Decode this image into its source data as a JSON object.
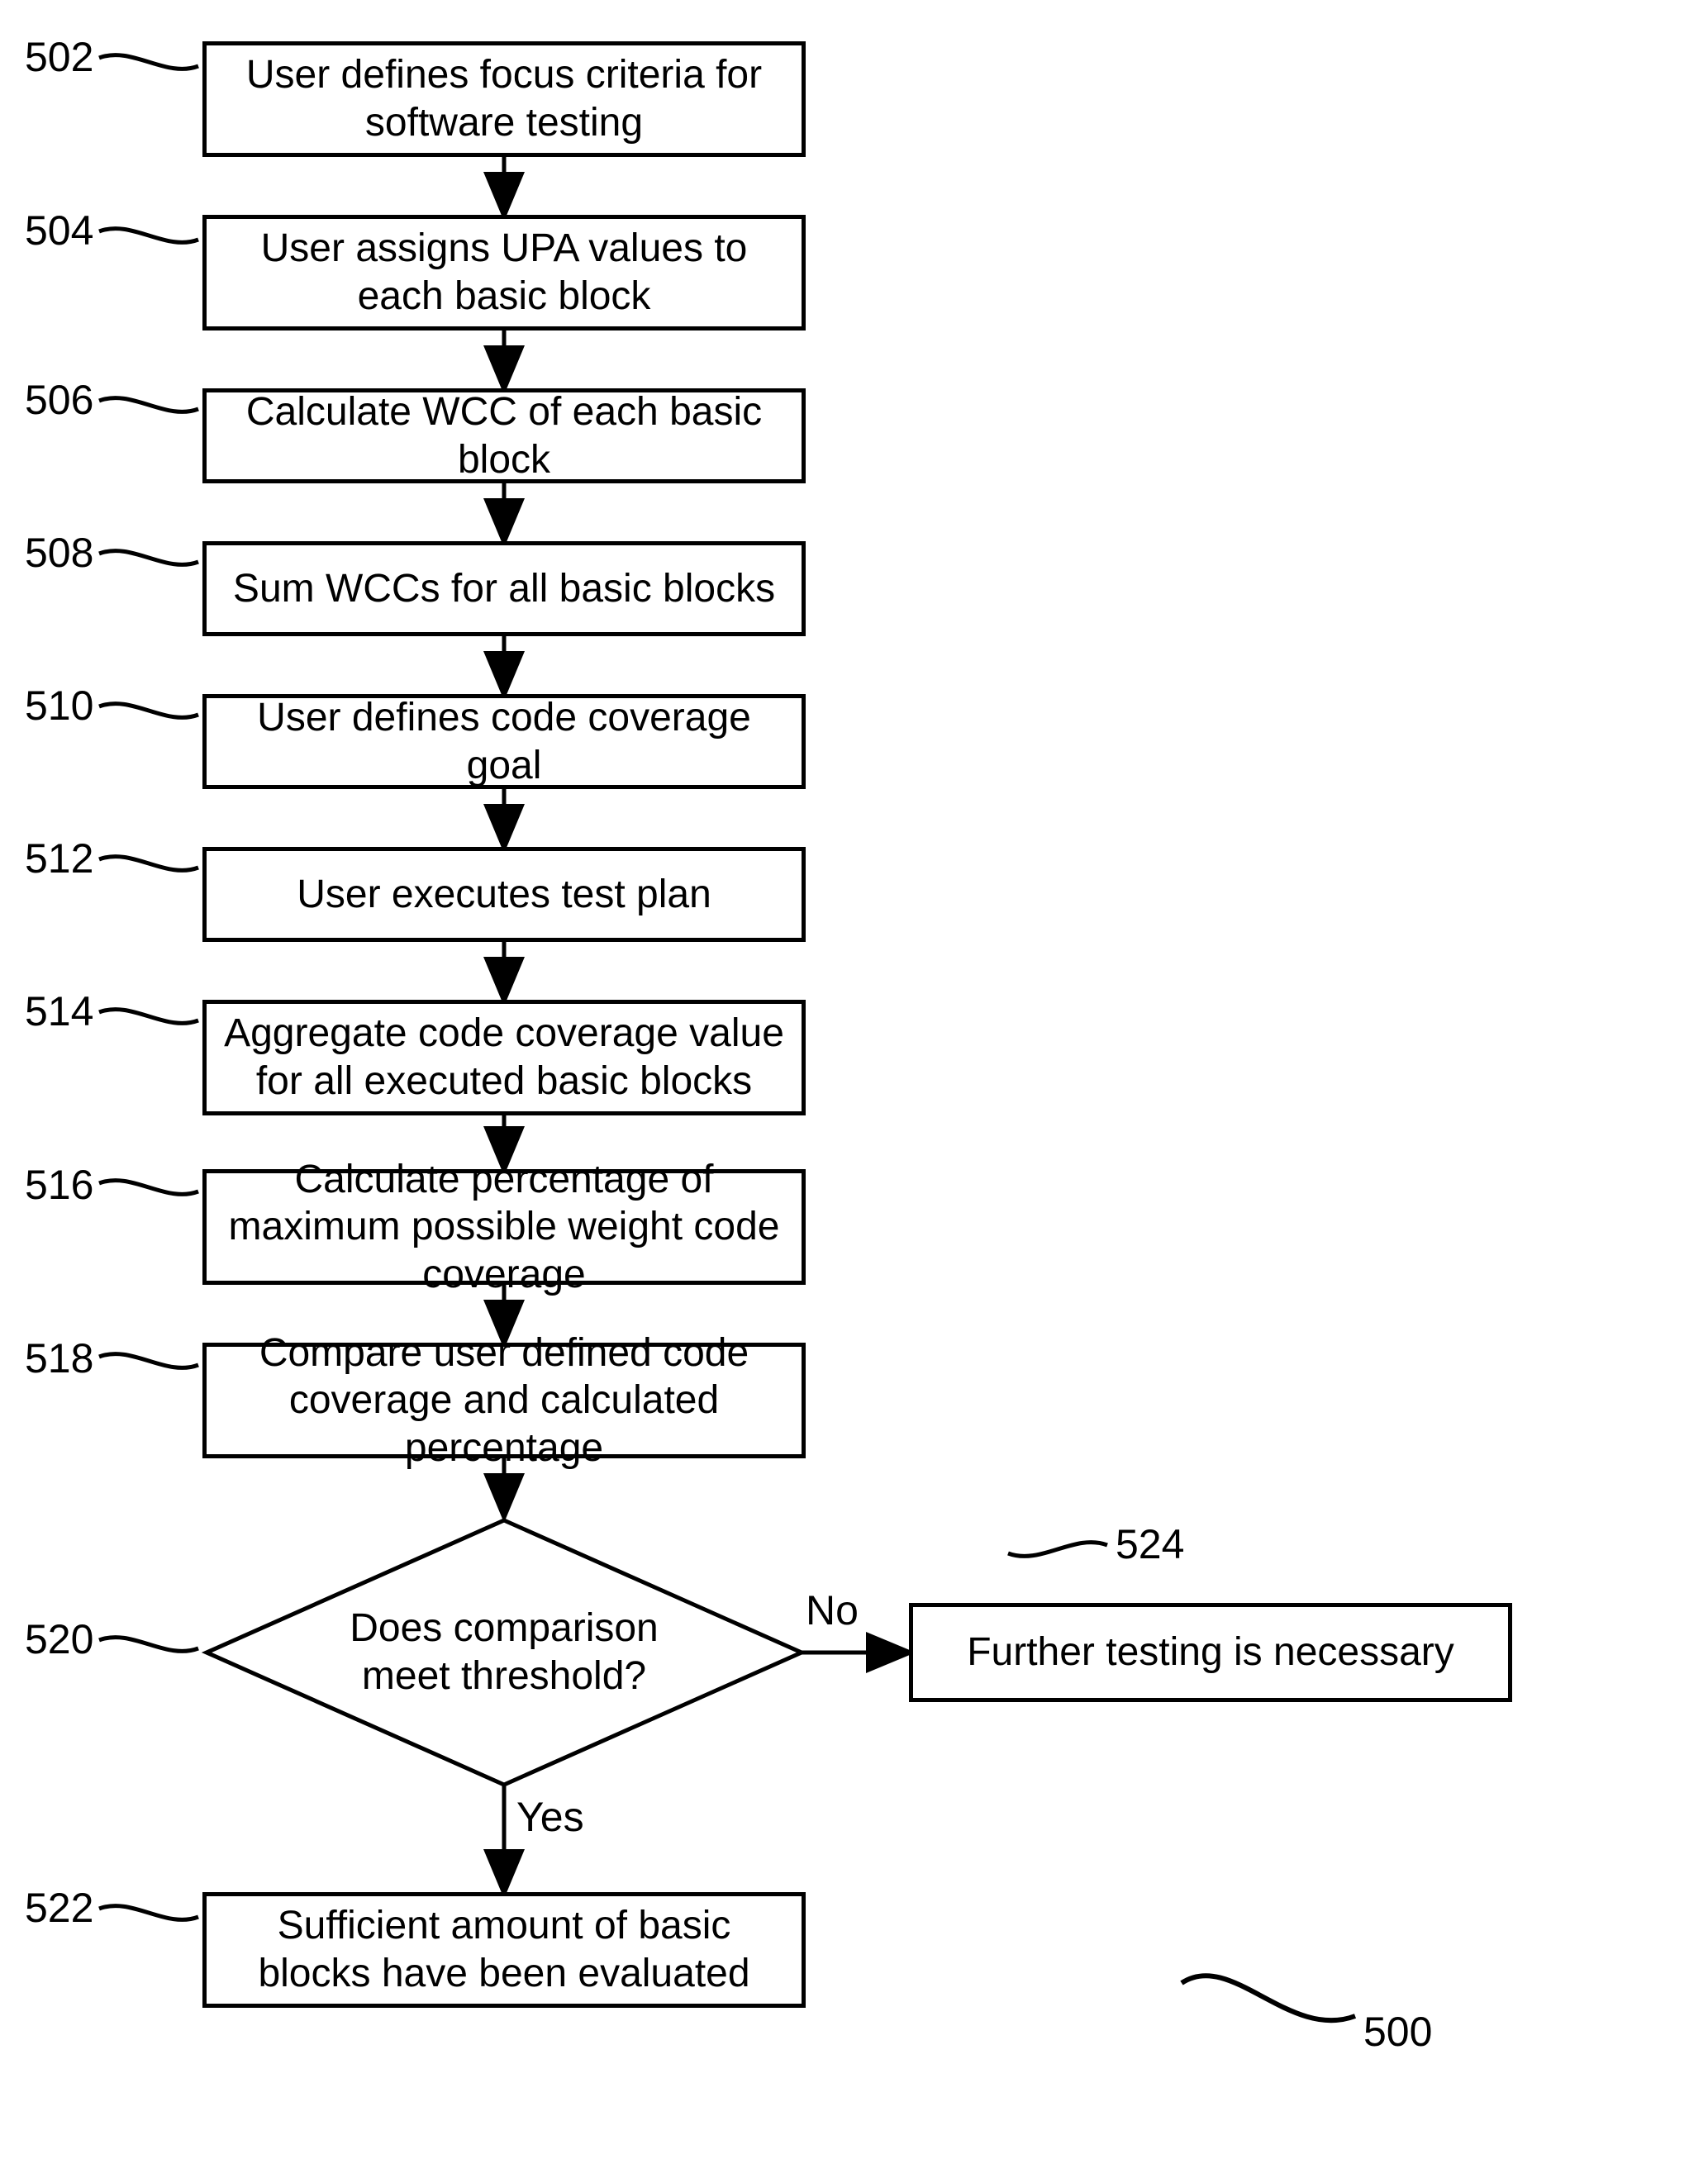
{
  "refs": {
    "r502": "502",
    "r504": "504",
    "r506": "506",
    "r508": "508",
    "r510": "510",
    "r512": "512",
    "r514": "514",
    "r516": "516",
    "r518": "518",
    "r520": "520",
    "r522": "522",
    "r524": "524",
    "r500": "500"
  },
  "boxes": {
    "b502": "User defines focus criteria for software testing",
    "b504": "User assigns UPA values to each basic block",
    "b506": "Calculate WCC of each basic block",
    "b508": "Sum WCCs for all basic blocks",
    "b510": "User defines code coverage goal",
    "b512": "User executes test plan",
    "b514": "Aggregate code coverage value for all executed basic blocks",
    "b516": "Calculate percentage of maximum possible weight code coverage",
    "b518": "Compare user defined code coverage and calculated percentage",
    "b520": "Does comparison meet threshold?",
    "b522": "Sufficient amount of basic blocks have been evaluated",
    "b524": "Further testing is necessary"
  },
  "labels": {
    "no": "No",
    "yes": "Yes"
  }
}
